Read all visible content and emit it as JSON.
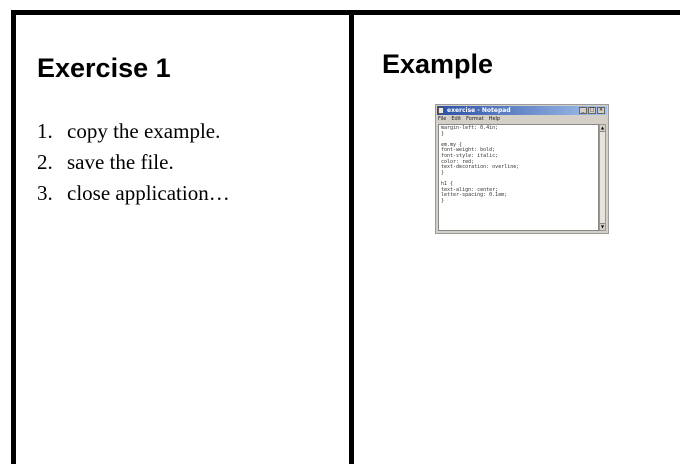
{
  "left_panel": {
    "heading": "Exercise 1",
    "steps": [
      {
        "number": "1.",
        "text": "copy the example."
      },
      {
        "number": "2.",
        "text": "save the file."
      },
      {
        "number": "3.",
        "text": "close application…"
      }
    ]
  },
  "right_panel": {
    "heading": "Example",
    "notepad": {
      "title": "exercise - Notepad",
      "controls": [
        "_",
        "□",
        "×"
      ],
      "menu": [
        "File",
        "Edit",
        "Format",
        "Help"
      ],
      "lines": [
        "margin-left: 0.4in;",
        "}",
        "",
        "em.my {",
        "font-weight: bold;",
        "font-style: italic;",
        "color: red;",
        "text-decoration: overline;",
        "}",
        "",
        "h1 {",
        "text-align: center;",
        "letter-spacing: 0.1em;",
        "}"
      ]
    }
  }
}
